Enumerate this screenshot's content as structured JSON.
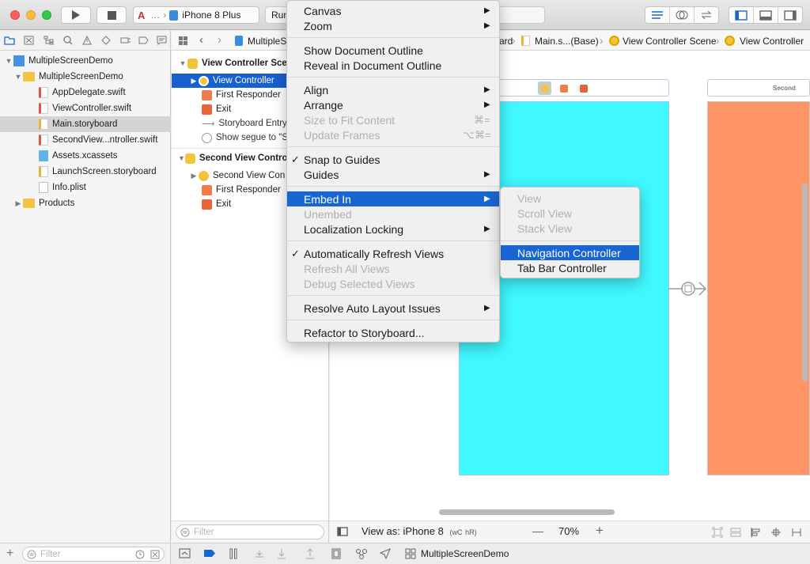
{
  "toolbar": {
    "scheme_separator": "…",
    "device": "iPhone 8 Plus",
    "status": "Run"
  },
  "navigator": {
    "items": [
      {
        "label": "MultipleScreenDemo",
        "kind": "project",
        "level": 0,
        "expanded": true
      },
      {
        "label": "MultipleScreenDemo",
        "kind": "folder",
        "level": 1,
        "expanded": true
      },
      {
        "label": "AppDelegate.swift",
        "kind": "swift",
        "level": 2
      },
      {
        "label": "ViewController.swift",
        "kind": "swift",
        "level": 2
      },
      {
        "label": "Main.storyboard",
        "kind": "storyboard",
        "level": 2,
        "selected": true
      },
      {
        "label": "SecondView...ntroller.swift",
        "kind": "swift",
        "level": 2
      },
      {
        "label": "Assets.xcassets",
        "kind": "assets",
        "level": 2
      },
      {
        "label": "LaunchScreen.storyboard",
        "kind": "storyboard",
        "level": 2
      },
      {
        "label": "Info.plist",
        "kind": "plist",
        "level": 2
      },
      {
        "label": "Products",
        "kind": "folder",
        "level": 1,
        "expanded": false
      }
    ],
    "filter_placeholder": "Filter"
  },
  "jumpbar": {
    "crumbs": [
      "MultipleS",
      "ard",
      "Main.s...(Base)",
      "View Controller Scene",
      "View Controller"
    ]
  },
  "outline": {
    "scene1_title": "View Controller Scene",
    "scene1_items": [
      "View Controller",
      "First Responder",
      "Exit",
      "Storyboard Entry",
      "Show segue to \"S"
    ],
    "scene2_title": "Second View Controller Scene",
    "scene2_items": [
      "Second View Con",
      "First Responder",
      "Exit"
    ],
    "filter_placeholder": "Filter"
  },
  "canvas": {
    "second_scene_label": "Second",
    "view_as": "View as: iPhone 8",
    "size_class_w": "wC",
    "size_class_h": "hR",
    "zoom_minus": "—",
    "zoom": "70%",
    "zoom_plus": "+",
    "colors": {
      "first_view": "#40f8ff",
      "second_view": "#ff9566",
      "selection": "#1966d2"
    }
  },
  "bottom_bar": {
    "scheme_label": "MultipleScreenDemo"
  },
  "context_menu": {
    "items": [
      {
        "label": "Canvas",
        "submenu": true
      },
      {
        "label": "Zoom",
        "submenu": true
      },
      {
        "label": "Show Document Outline"
      },
      {
        "label": "Reveal in Document Outline"
      },
      {
        "label": "Align",
        "submenu": true
      },
      {
        "label": "Arrange",
        "submenu": true
      },
      {
        "label": "Size to Fit Content",
        "shortcut": "⌘=",
        "disabled": true
      },
      {
        "label": "Update Frames",
        "shortcut": "⌥⌘=",
        "disabled": true
      },
      {
        "label": "Snap to Guides",
        "checked": true
      },
      {
        "label": "Guides",
        "submenu": true
      },
      {
        "label": "Embed In",
        "submenu": true,
        "highlighted": true
      },
      {
        "label": "Unembed",
        "disabled": true
      },
      {
        "label": "Localization Locking",
        "submenu": true
      },
      {
        "label": "Automatically Refresh Views",
        "checked": true
      },
      {
        "label": "Refresh All Views",
        "disabled": true
      },
      {
        "label": "Debug Selected Views",
        "disabled": true
      },
      {
        "label": "Resolve Auto Layout Issues",
        "submenu": true
      },
      {
        "label": "Refactor to Storyboard..."
      }
    ]
  },
  "embed_submenu": {
    "items": [
      {
        "label": "View",
        "disabled": true
      },
      {
        "label": "Scroll View",
        "disabled": true
      },
      {
        "label": "Stack View",
        "disabled": true
      },
      {
        "label": "Navigation Controller",
        "highlighted": true
      },
      {
        "label": "Tab Bar Controller"
      }
    ]
  }
}
